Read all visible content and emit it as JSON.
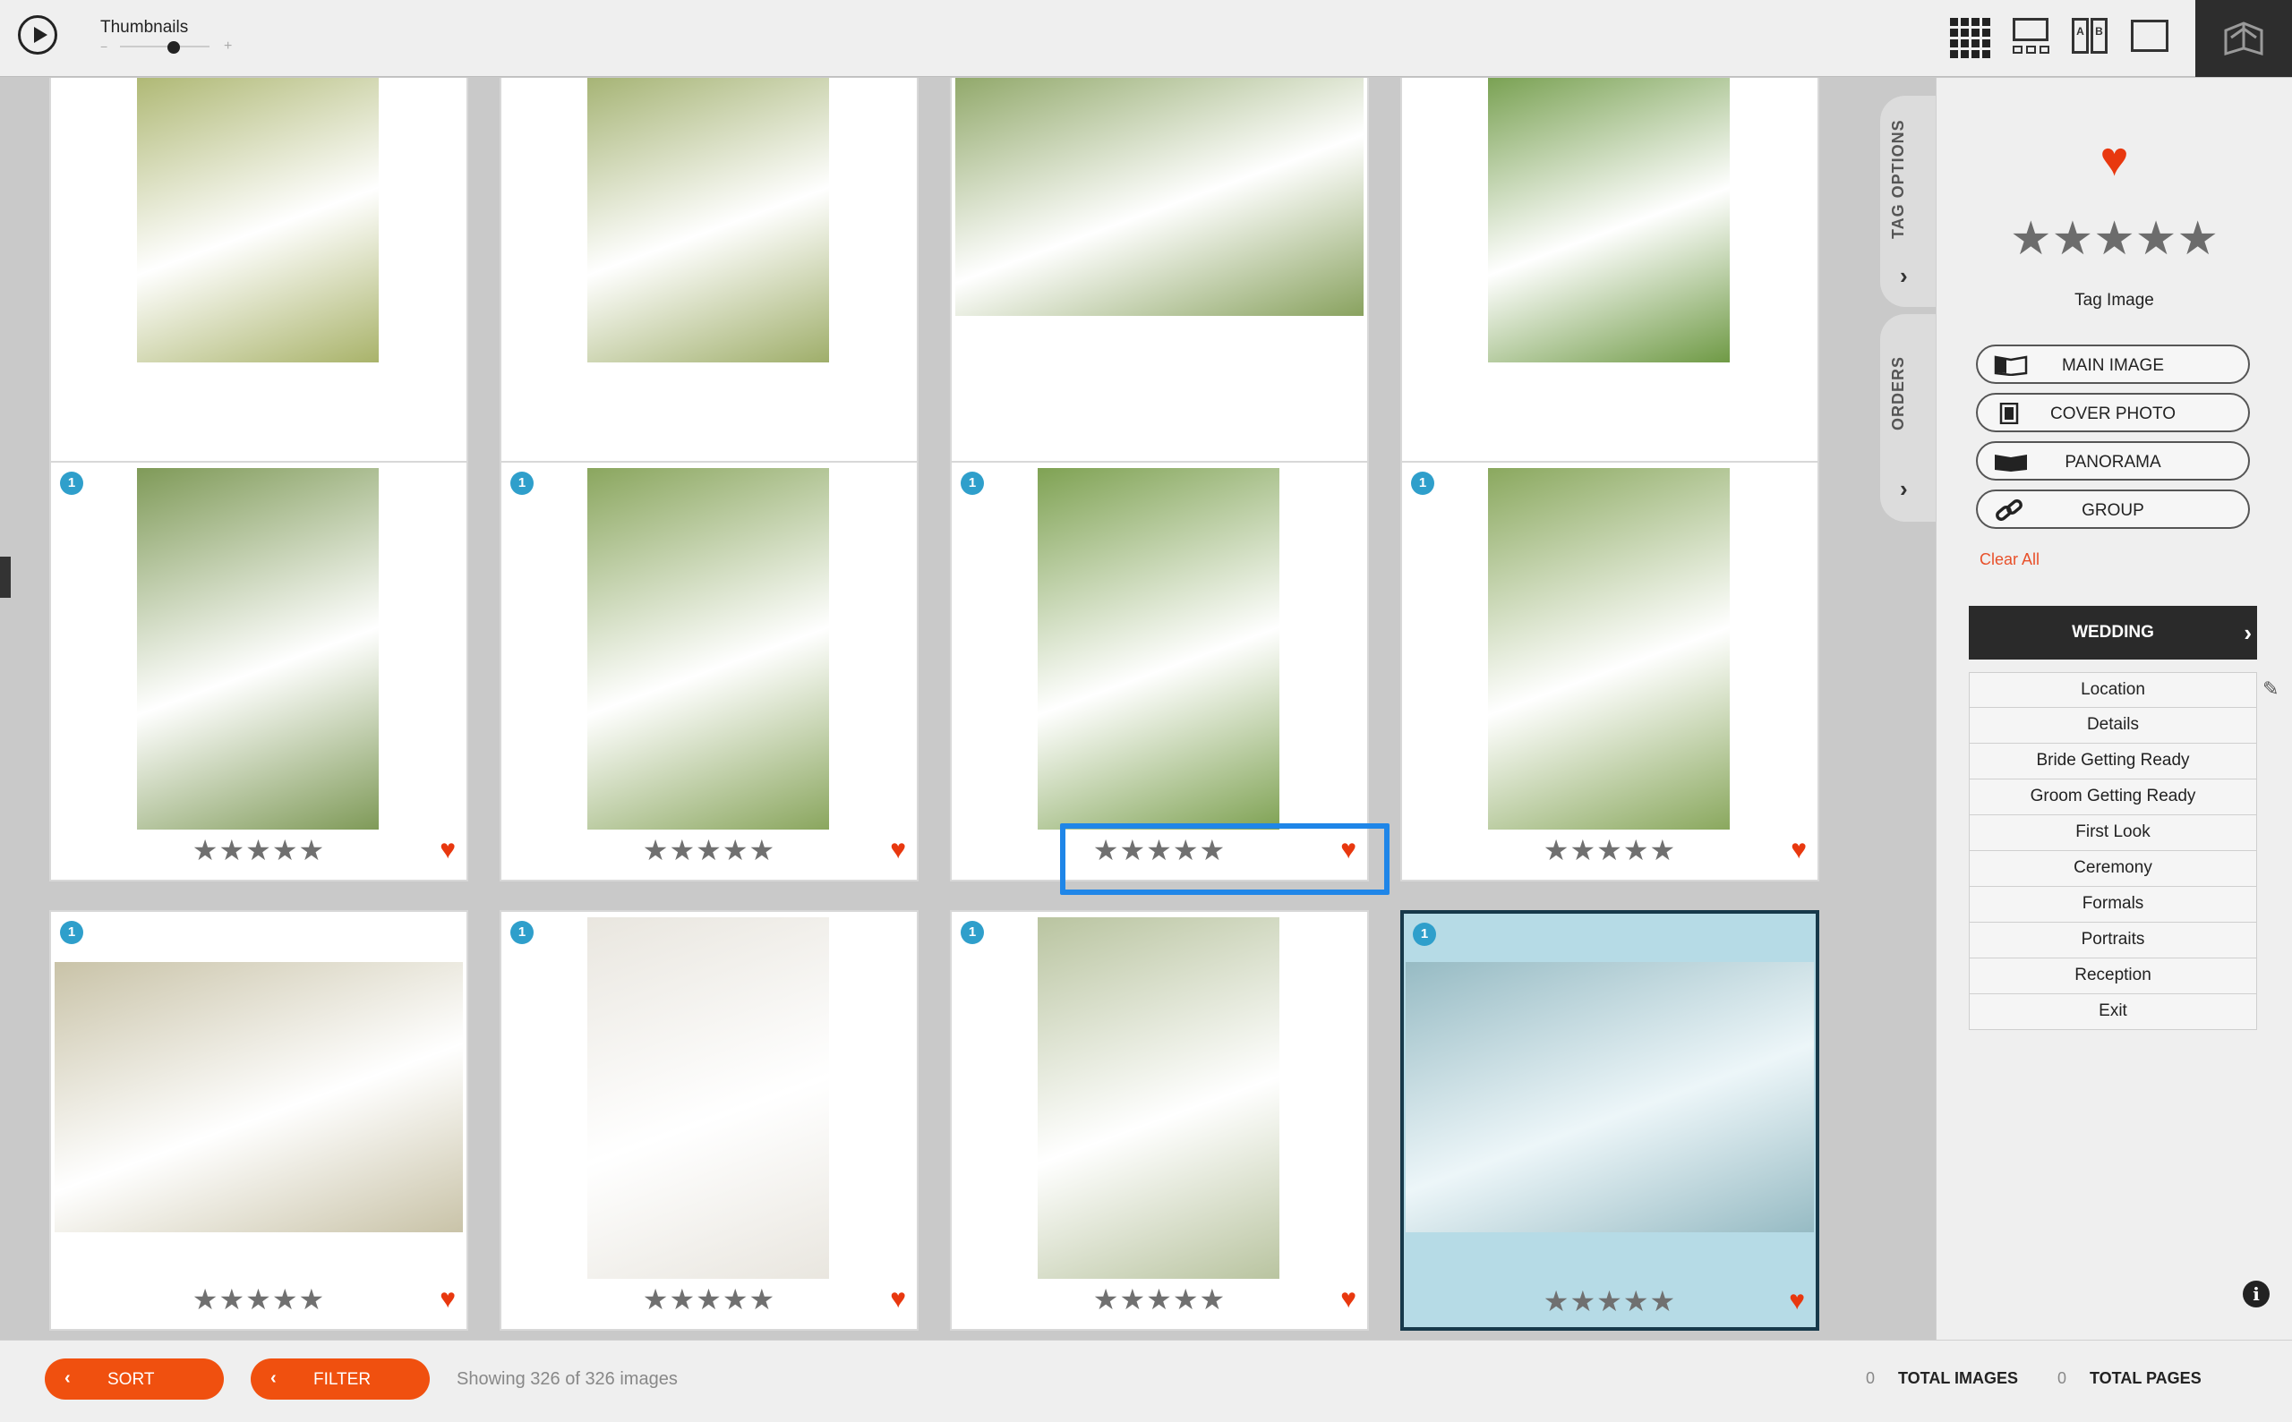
{
  "toolbar": {
    "thumbnails_label": "Thumbnails",
    "slider_minus": "−",
    "slider_plus": "+",
    "view_modes": [
      "grid-view",
      "spread-view",
      "ab-compare-view",
      "single-view"
    ],
    "ab_labels": [
      "A",
      "B"
    ]
  },
  "grid": {
    "cards": [
      {
        "badge": "",
        "stars": "★★★★★",
        "heart": "♥",
        "photo_color": "#a9b36a"
      },
      {
        "badge": "",
        "stars": "★★★★★",
        "heart": "♥",
        "photo_color": "#9fae6a"
      },
      {
        "badge": "",
        "stars": "★★★★★",
        "heart": "♥",
        "photo_color": "#89a25f"
      },
      {
        "badge": "",
        "stars": "★★★★★",
        "heart": "♥",
        "photo_color": "#6f9a45"
      },
      {
        "badge": "1",
        "stars": "★★★★★",
        "heart": "♥",
        "photo_color": "#7f9a58"
      },
      {
        "badge": "1",
        "stars": "★★★★★",
        "heart": "♥",
        "photo_color": "#8aa65e"
      },
      {
        "badge": "1",
        "stars": "★★★★★",
        "heart": "♥",
        "photo_color": "#7fa253"
      },
      {
        "badge": "1",
        "stars": "★★★★★",
        "heart": "♥",
        "photo_color": "#8aa85e"
      },
      {
        "badge": "1",
        "stars": "★★★★★",
        "heart": "♥",
        "photo_color": "#c9c3a8"
      },
      {
        "badge": "1",
        "stars": "★★★★★",
        "heart": "♥",
        "photo_color": "#e9e6df"
      },
      {
        "badge": "1",
        "stars": "★★★★★",
        "heart": "♥",
        "photo_color": "#b9c4a0"
      },
      {
        "badge": "1",
        "stars": "★★★★★",
        "heart": "♥",
        "photo_color": "#8cb0b8"
      }
    ]
  },
  "side_tabs": {
    "tag_options": "TAG OPTIONS",
    "orders": "ORDERS",
    "chevron": "›"
  },
  "panel": {
    "heart": "♥",
    "stars": "★★★★★",
    "tag_image_label": "Tag Image",
    "buttons": [
      "MAIN IMAGE",
      "COVER PHOTO",
      "PANORAMA",
      "GROUP"
    ],
    "clear_all": "Clear All",
    "category": "WEDDING",
    "category_arrow": "›",
    "sections": [
      "Location",
      "Details",
      "Bride Getting Ready",
      "Groom Getting Ready",
      "First Look",
      "Ceremony",
      "Formals",
      "Portraits",
      "Reception",
      "Exit"
    ],
    "info": "i"
  },
  "bottom": {
    "sort_label": "SORT",
    "filter_label": "FILTER",
    "arrow": "‹",
    "showing": "Showing 326 of 326 images",
    "total_images_count": "0",
    "total_images_label": "TOTAL IMAGES",
    "total_pages_count": "0",
    "total_pages_label": "TOTAL PAGES"
  },
  "colors": {
    "accent": "#f0500f",
    "heart": "#e8380f",
    "badge": "#2f9fcb",
    "selected_bg": "#b6dbe6",
    "focus": "#1f86e8"
  }
}
